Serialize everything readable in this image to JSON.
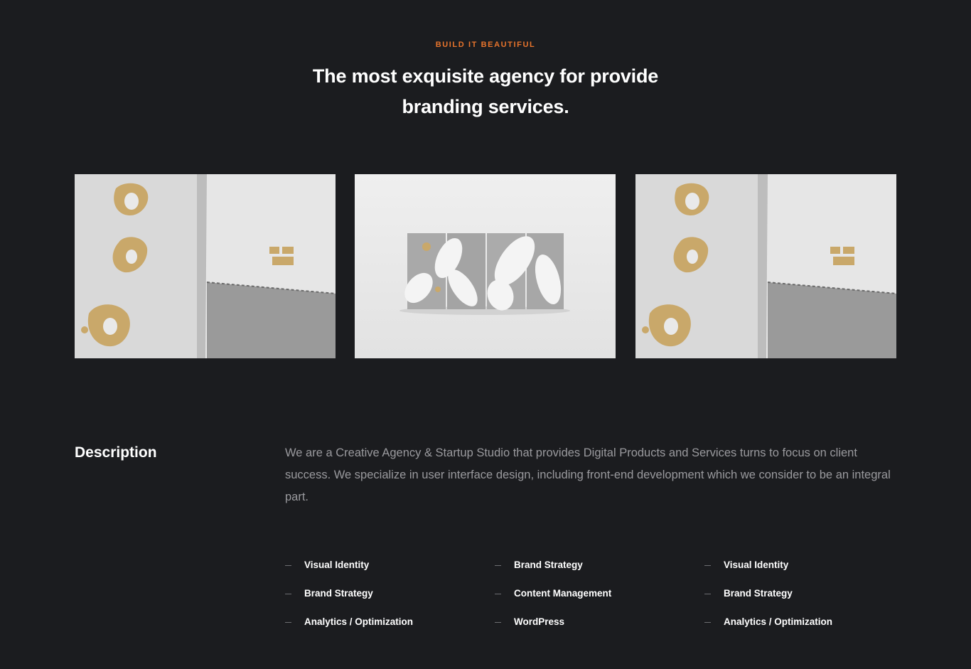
{
  "hero": {
    "eyebrow": "BUILD IT BEAUTIFUL",
    "title": "The most exquisite agency for provide branding services."
  },
  "gallery": {
    "images": [
      {
        "alt": "Packaging boxes with gold emblems"
      },
      {
        "alt": "White and grey box set"
      },
      {
        "alt": "Packaging boxes with gold emblems"
      }
    ]
  },
  "description": {
    "title": "Description",
    "body": "We are a Creative Agency & Startup Studio that provides Digital Products and Services turns to focus on client success. We specialize in user interface design, including front-end development which we consider to be an integral part."
  },
  "services": {
    "columns": [
      {
        "items": [
          {
            "label": "Visual Identity"
          },
          {
            "label": "Brand Strategy"
          },
          {
            "label": "Analytics / Optimization"
          }
        ]
      },
      {
        "items": [
          {
            "label": "Brand Strategy"
          },
          {
            "label": "Content Management"
          },
          {
            "label": "WordPress"
          }
        ]
      },
      {
        "items": [
          {
            "label": "Visual Identity"
          },
          {
            "label": "Brand Strategy"
          },
          {
            "label": "Analytics / Optimization"
          }
        ]
      }
    ]
  },
  "colors": {
    "background": "#1b1c1f",
    "accent": "#e8742c",
    "text": "#ffffff",
    "muted": "#9a9a9e",
    "gold": "#c9a86a"
  }
}
